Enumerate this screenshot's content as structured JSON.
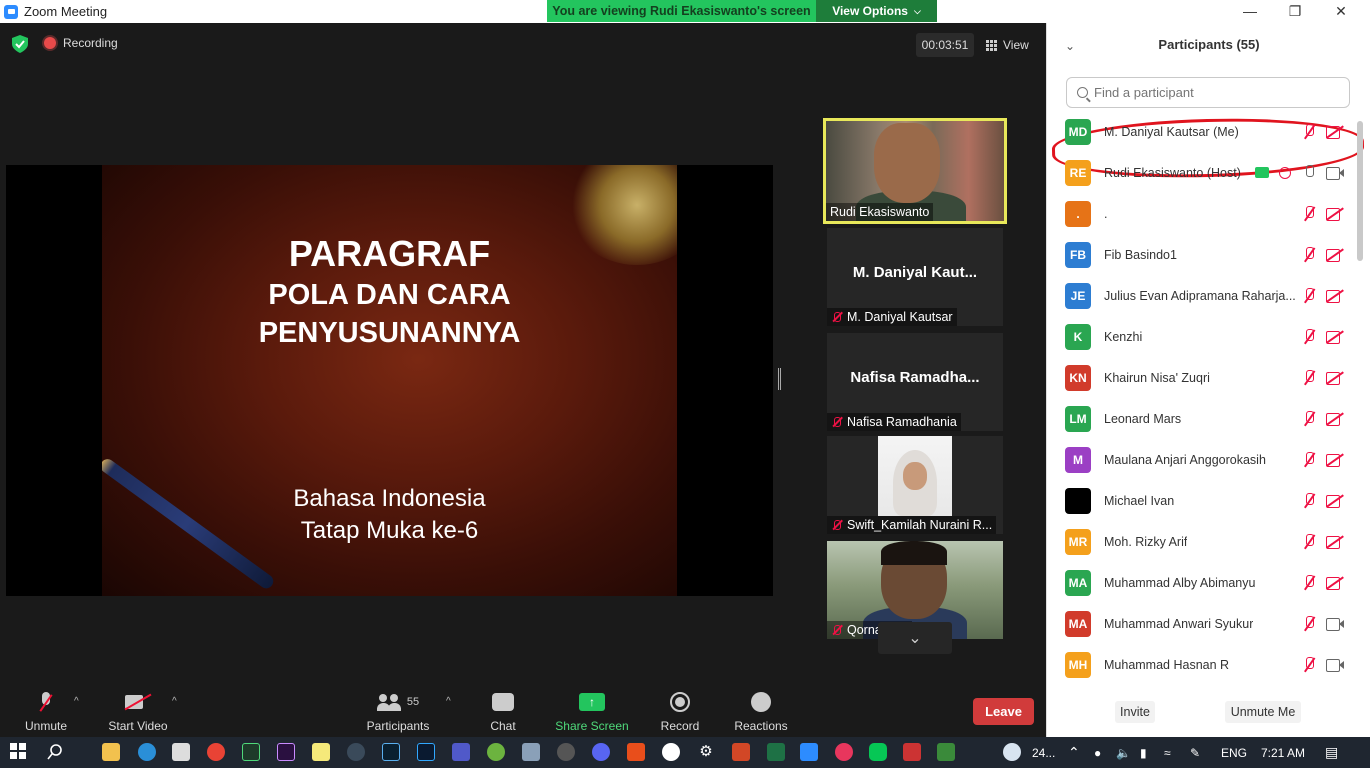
{
  "window": {
    "title": "Zoom Meeting",
    "viewing_banner": "You are viewing Rudi Ekasiswanto's screen",
    "view_options": "View Options",
    "minimize": "—",
    "restore": "❐",
    "close": "✕"
  },
  "meeting_header": {
    "recording": "Recording",
    "timer": "00:03:51",
    "view_label": "View"
  },
  "slide": {
    "line1": "PARAGRAF",
    "line2": "POLA DAN CARA",
    "line3": "PENYUSUNANNYA",
    "line4": "Bahasa Indonesia",
    "line5": "Tatap Muka ke-6"
  },
  "thumbnails": [
    {
      "name": "Rudi Ekasiswanto",
      "video": true,
      "active": true
    },
    {
      "center_name": "M. Daniyal Kaut...",
      "name": "M. Daniyal Kautsar",
      "muted": true
    },
    {
      "center_name": "Nafisa Ramadha...",
      "name": "Nafisa Ramadhania",
      "muted": true
    },
    {
      "name": "Swift_Kamilah Nuraini R...",
      "muted": true,
      "video": true
    },
    {
      "name": "Qornain Aji",
      "muted": true,
      "video": true
    }
  ],
  "thumb_scroll": "⌄",
  "toolbar": {
    "unmute": "Unmute",
    "start_video": "Start Video",
    "participants": "Participants",
    "participants_count": "55",
    "chat": "Chat",
    "share_screen": "Share Screen",
    "record": "Record",
    "reactions": "Reactions",
    "leave": "Leave",
    "caret": "^"
  },
  "panel": {
    "collapse_icon": "⌄",
    "header": "Participants (55)",
    "search_placeholder": "Find a participant",
    "invite": "Invite",
    "unmute_me": "Unmute Me"
  },
  "participants": [
    {
      "initials": "MD",
      "color": "#2aa651",
      "name": "M. Daniyal Kautsar (Me)",
      "mic": "muted",
      "cam": "off"
    },
    {
      "initials": "RE",
      "color": "#f4a01c",
      "name": "Rudi Ekasiswanto (Host)",
      "mic": "on",
      "cam": "on",
      "sharing": true,
      "recording": true
    },
    {
      "initials": ".",
      "color": "#e67317",
      "name": ".",
      "mic": "muted",
      "cam": "off"
    },
    {
      "initials": "FB",
      "color": "#2d7dd2",
      "name": "Fib Basindo1",
      "mic": "muted",
      "cam": "off"
    },
    {
      "initials": "JE",
      "color": "#2d7dd2",
      "name": "Julius Evan Adipramana Raharja...",
      "mic": "muted",
      "cam": "off"
    },
    {
      "initials": "K",
      "color": "#2aa651",
      "name": "Kenzhi",
      "mic": "muted",
      "cam": "off"
    },
    {
      "initials": "KN",
      "color": "#d13b2b",
      "name": "Khairun Nisa' Zuqri",
      "mic": "muted",
      "cam": "off"
    },
    {
      "initials": "LM",
      "color": "#2aa651",
      "name": "Leonard Mars",
      "mic": "muted",
      "cam": "off"
    },
    {
      "initials": "M",
      "color": "#9b3fc4",
      "name": "Maulana Anjari Anggorokasih",
      "mic": "muted",
      "cam": "off"
    },
    {
      "initials": "",
      "color": "#000000",
      "name": "Michael Ivan",
      "mic": "muted",
      "cam": "off"
    },
    {
      "initials": "MR",
      "color": "#f4a01c",
      "name": "Moh. Rizky Arif",
      "mic": "muted",
      "cam": "off"
    },
    {
      "initials": "MA",
      "color": "#2aa651",
      "name": "Muhammad Alby Abimanyu",
      "mic": "muted",
      "cam": "off"
    },
    {
      "initials": "MA",
      "color": "#d13b2b",
      "name": "Muhammad Anwari Syukur",
      "mic": "muted",
      "cam": "on"
    },
    {
      "initials": "MH",
      "color": "#f4a01c",
      "name": "Muhammad Hasnan R",
      "mic": "muted",
      "cam": "on"
    }
  ],
  "taskbar": {
    "weather": "24...",
    "lang": "ENG",
    "time": "7:21 AM"
  }
}
